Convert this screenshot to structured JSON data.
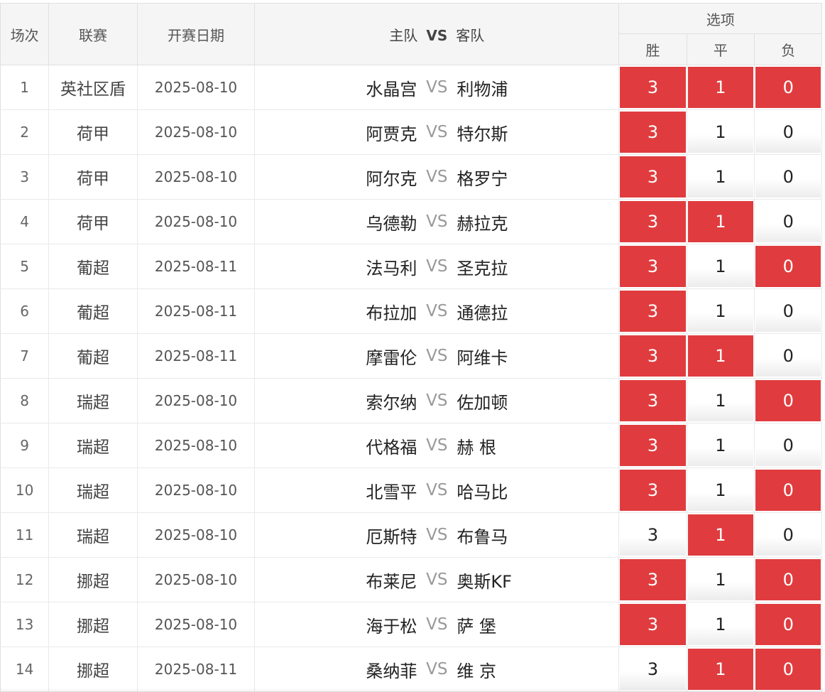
{
  "header": {
    "round": "场次",
    "league": "联赛",
    "date": "开赛日期",
    "home": "主队",
    "vs": "VS",
    "away": "客队",
    "options": "选项",
    "win": "胜",
    "draw": "平",
    "lose": "负"
  },
  "colors": {
    "selected": "#e03c3f"
  },
  "matches": [
    {
      "no": "1",
      "league": "英社区盾",
      "date": "2025-08-10",
      "home": "水晶宫",
      "vs": "VS",
      "away": "利物浦",
      "win": "3",
      "draw": "1",
      "lose": "0",
      "sel": [
        true,
        true,
        true
      ]
    },
    {
      "no": "2",
      "league": "荷甲",
      "date": "2025-08-10",
      "home": "阿贾克",
      "vs": "VS",
      "away": "特尔斯",
      "win": "3",
      "draw": "1",
      "lose": "0",
      "sel": [
        true,
        false,
        false
      ]
    },
    {
      "no": "3",
      "league": "荷甲",
      "date": "2025-08-10",
      "home": "阿尔克",
      "vs": "VS",
      "away": "格罗宁",
      "win": "3",
      "draw": "1",
      "lose": "0",
      "sel": [
        true,
        false,
        false
      ]
    },
    {
      "no": "4",
      "league": "荷甲",
      "date": "2025-08-10",
      "home": "乌德勒",
      "vs": "VS",
      "away": "赫拉克",
      "win": "3",
      "draw": "1",
      "lose": "0",
      "sel": [
        true,
        true,
        false
      ]
    },
    {
      "no": "5",
      "league": "葡超",
      "date": "2025-08-11",
      "home": "法马利",
      "vs": "VS",
      "away": "圣克拉",
      "win": "3",
      "draw": "1",
      "lose": "0",
      "sel": [
        true,
        false,
        true
      ]
    },
    {
      "no": "6",
      "league": "葡超",
      "date": "2025-08-11",
      "home": "布拉加",
      "vs": "VS",
      "away": "通德拉",
      "win": "3",
      "draw": "1",
      "lose": "0",
      "sel": [
        true,
        false,
        false
      ]
    },
    {
      "no": "7",
      "league": "葡超",
      "date": "2025-08-11",
      "home": "摩雷伦",
      "vs": "VS",
      "away": "阿维卡",
      "win": "3",
      "draw": "1",
      "lose": "0",
      "sel": [
        true,
        true,
        false
      ]
    },
    {
      "no": "8",
      "league": "瑞超",
      "date": "2025-08-10",
      "home": "索尔纳",
      "vs": "VS",
      "away": "佐加顿",
      "win": "3",
      "draw": "1",
      "lose": "0",
      "sel": [
        true,
        false,
        true
      ]
    },
    {
      "no": "9",
      "league": "瑞超",
      "date": "2025-08-10",
      "home": "代格福",
      "vs": "VS",
      "away": "赫 根",
      "win": "3",
      "draw": "1",
      "lose": "0",
      "sel": [
        true,
        false,
        false
      ]
    },
    {
      "no": "10",
      "league": "瑞超",
      "date": "2025-08-10",
      "home": "北雪平",
      "vs": "VS",
      "away": "哈马比",
      "win": "3",
      "draw": "1",
      "lose": "0",
      "sel": [
        true,
        false,
        true
      ]
    },
    {
      "no": "11",
      "league": "瑞超",
      "date": "2025-08-10",
      "home": "厄斯特",
      "vs": "VS",
      "away": "布鲁马",
      "win": "3",
      "draw": "1",
      "lose": "0",
      "sel": [
        false,
        true,
        false
      ]
    },
    {
      "no": "12",
      "league": "挪超",
      "date": "2025-08-10",
      "home": "布莱尼",
      "vs": "VS",
      "away": "奥斯KF",
      "win": "3",
      "draw": "1",
      "lose": "0",
      "sel": [
        true,
        false,
        true
      ]
    },
    {
      "no": "13",
      "league": "挪超",
      "date": "2025-08-10",
      "home": "海于松",
      "vs": "VS",
      "away": "萨 堡",
      "win": "3",
      "draw": "1",
      "lose": "0",
      "sel": [
        true,
        false,
        true
      ]
    },
    {
      "no": "14",
      "league": "挪超",
      "date": "2025-08-11",
      "home": "桑纳菲",
      "vs": "VS",
      "away": "维 京",
      "win": "3",
      "draw": "1",
      "lose": "0",
      "sel": [
        false,
        true,
        true
      ]
    }
  ]
}
